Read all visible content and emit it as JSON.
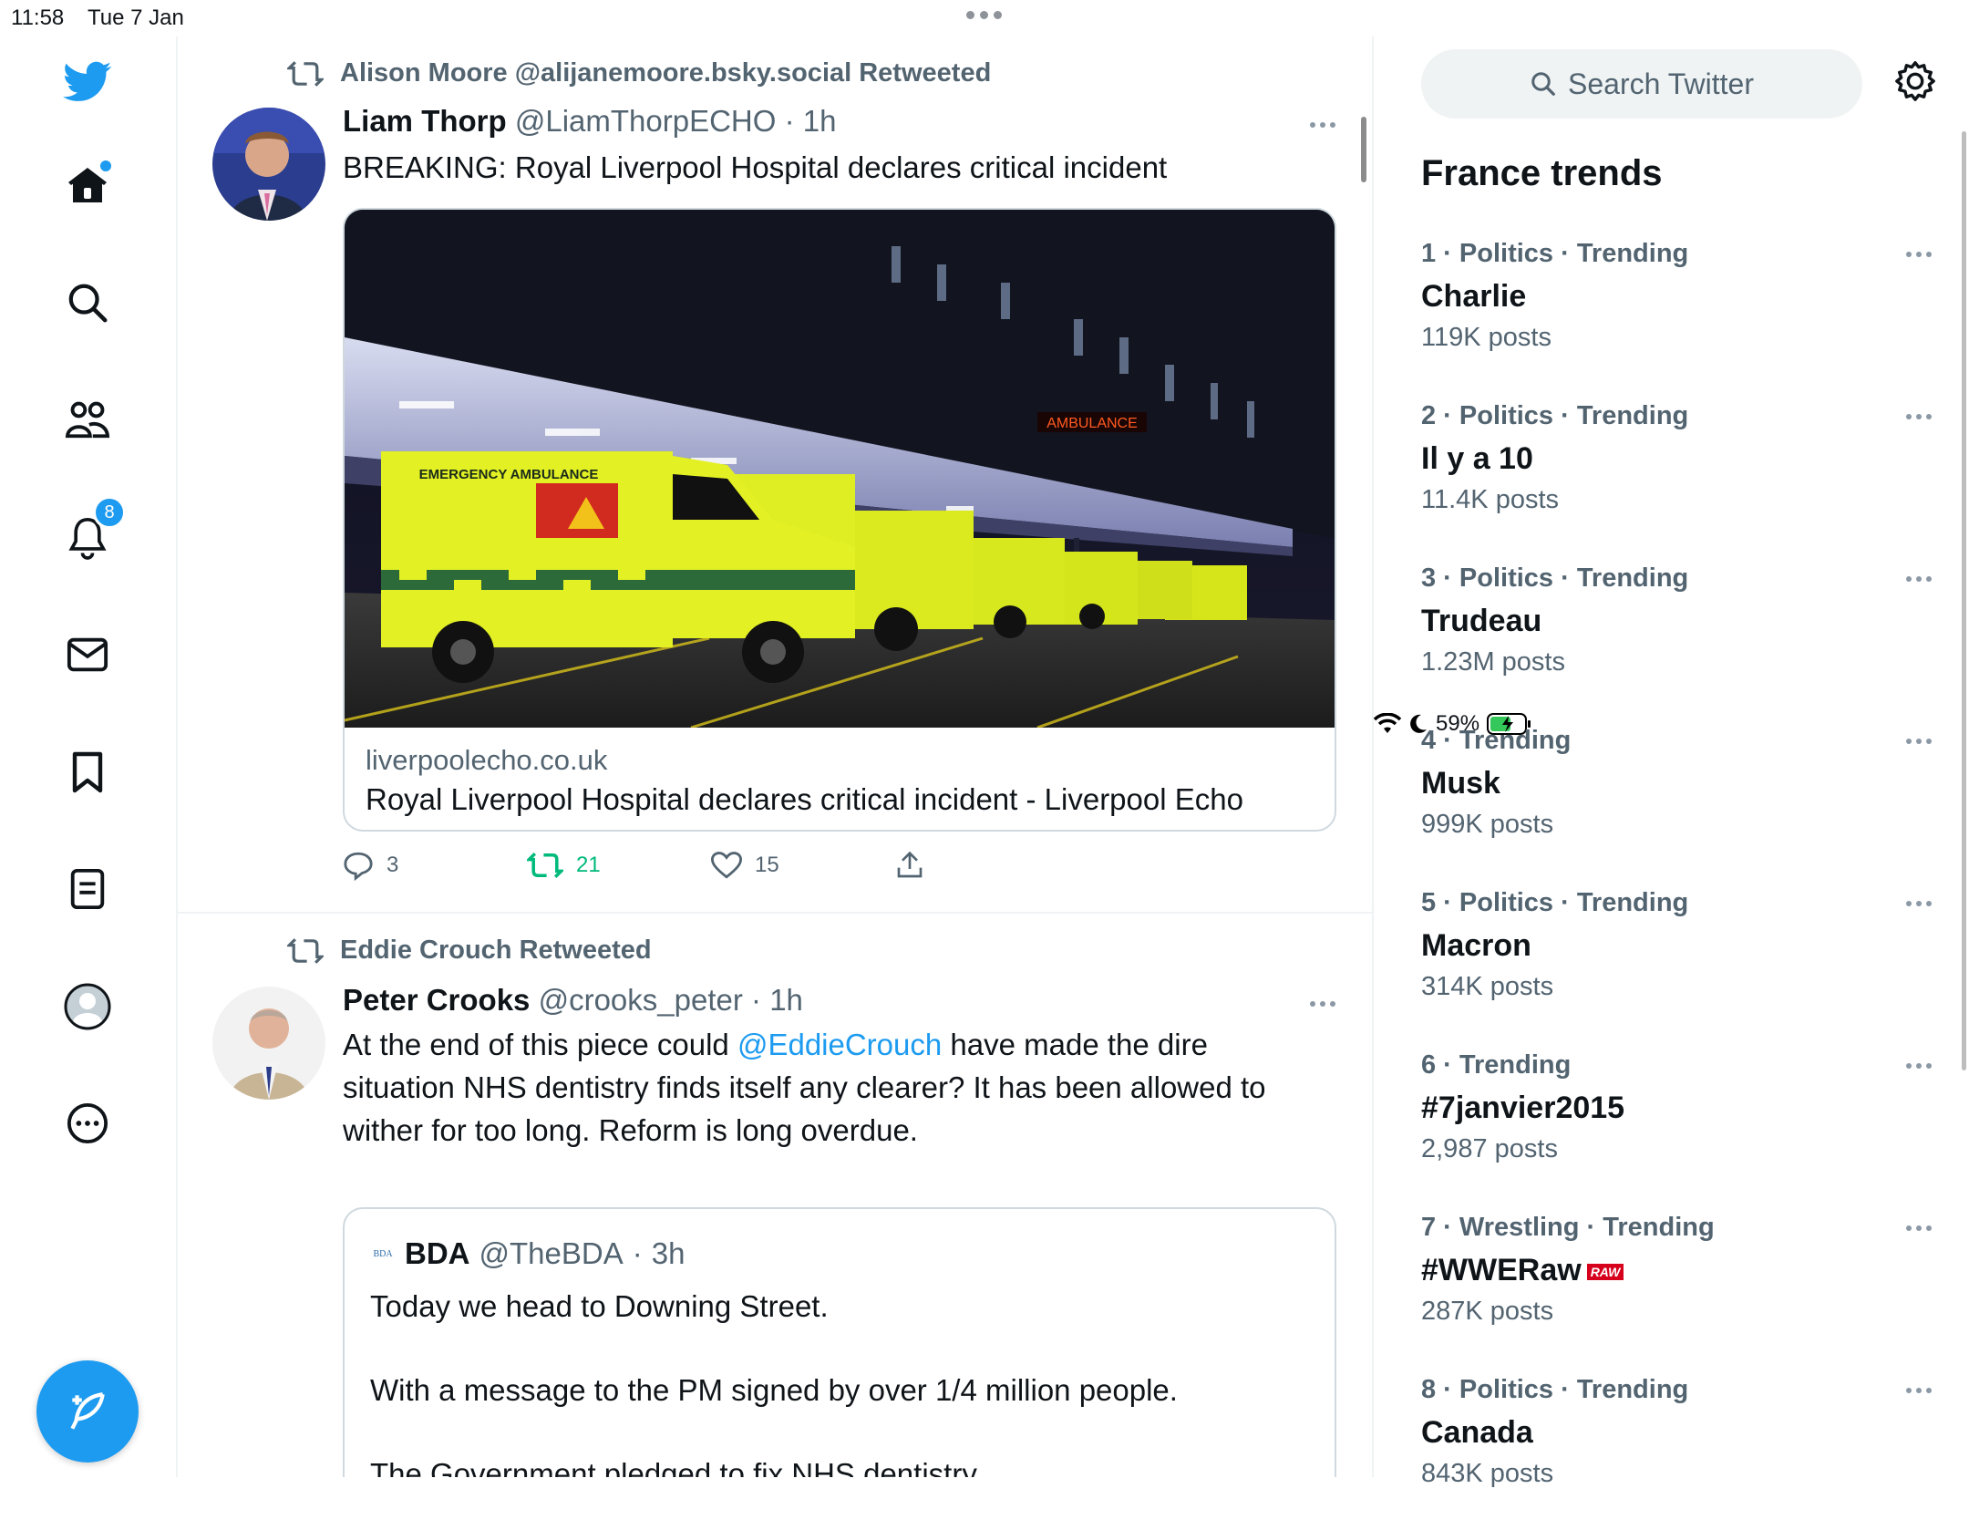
{
  "status_bar": {
    "time": "11:58",
    "date": "Tue 7 Jan",
    "battery": "59%"
  },
  "sidebar": {
    "notifications_badge": "8"
  },
  "tweets": [
    {
      "retweeted_by": "Alison Moore @alijanemoore.bsky.social Retweeted",
      "author": "Liam Thorp",
      "handle": "@LiamThorpECHO",
      "time": "1h",
      "text": "BREAKING: Royal Liverpool Hospital declares critical incident",
      "card": {
        "domain": "liverpoolecho.co.uk",
        "title": "Royal Liverpool Hospital declares critical incident - Liverpool Echo",
        "image_alt": "Row of yellow emergency ambulances parked outside hospital at night",
        "ambulance_text": "EMERGENCY AMBULANCE",
        "sign_text": "AMBULANCE"
      },
      "replies": "3",
      "retweets": "21",
      "likes": "15"
    },
    {
      "retweeted_by": "Eddie Crouch Retweeted",
      "author": "Peter Crooks",
      "handle": "@crooks_peter",
      "time": "1h",
      "text_before": "At the end of this piece could ",
      "mention": "@EddieCrouch",
      "text_line1_after": " have made the dire",
      "text_line2": "situation NHS dentistry finds itself any clearer? It has been allowed to",
      "text_line3": "wither for too long. Reform is long overdue.",
      "quote": {
        "logo": "BDA",
        "author": "BDA",
        "handle": "@TheBDA",
        "time": "3h",
        "line1": "Today we head to Downing Street.",
        "line2": "With a message to the PM signed by over 1/4 million people.",
        "line3": "The Government pledged to fix NHS dentistry."
      }
    }
  ],
  "right": {
    "search_placeholder": "Search Twitter",
    "trends_title": "France trends",
    "trends": [
      {
        "meta": "1 · Politics · Trending",
        "name": "Charlie",
        "count": "119K posts"
      },
      {
        "meta": "2 · Politics · Trending",
        "name": "Il y a 10",
        "count": "11.4K posts"
      },
      {
        "meta": "3 · Politics · Trending",
        "name": "Trudeau",
        "count": "1.23M posts"
      },
      {
        "meta": "4 · Trending",
        "name": "Musk",
        "count": "999K posts"
      },
      {
        "meta": "5 · Politics · Trending",
        "name": "Macron",
        "count": "314K posts"
      },
      {
        "meta": "6 · Trending",
        "name": "#7janvier2015",
        "count": "2,987 posts"
      },
      {
        "meta": "7 · Wrestling · Trending",
        "name": "#WWERaw",
        "badge": "RAW",
        "count": "287K posts"
      },
      {
        "meta": "8 · Politics · Trending",
        "name": "Canada",
        "count": "843K posts"
      }
    ]
  }
}
